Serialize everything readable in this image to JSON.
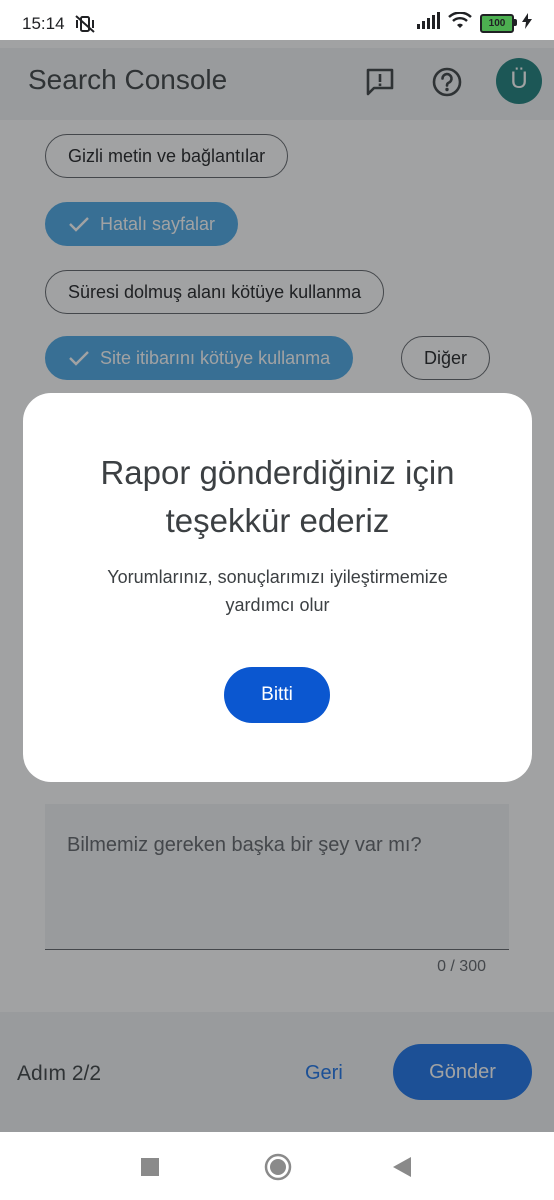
{
  "status_bar": {
    "time": "15:14",
    "battery": "100"
  },
  "app": {
    "title": "Search Console",
    "avatar_letter": "Ü",
    "icons": [
      "feedback-icon",
      "help-icon"
    ]
  },
  "chips": [
    {
      "label": "Gizli metin ve bağlantılar",
      "selected": false
    },
    {
      "label": "Hatalı sayfalar",
      "selected": true
    },
    {
      "label": "Süresi dolmuş alanı kötüye kullanma",
      "selected": false
    },
    {
      "label": "Site itibarını kötüye kullanma",
      "selected": true
    },
    {
      "label": "Diğer",
      "selected": false
    }
  ],
  "comment": {
    "placeholder": "Bilmemiz gereken başka bir şey var mı?",
    "counter": "0 / 300"
  },
  "footer": {
    "step": "Adım 2/2",
    "back_label": "Geri",
    "send_label": "Gönder"
  },
  "dialog": {
    "title_line1": "Rapor gönderdiğiniz için",
    "title_line2": "teşekkür ederiz",
    "body_line1": "Yorumlarınız, sonuçlarımızı iyileştirmemize",
    "body_line2": "yardımcı olur",
    "done_label": "Bitti"
  },
  "colors": {
    "accent": "#0b57d0",
    "chip_selected": "#4aa8e6",
    "avatar": "#1a7f7a"
  }
}
